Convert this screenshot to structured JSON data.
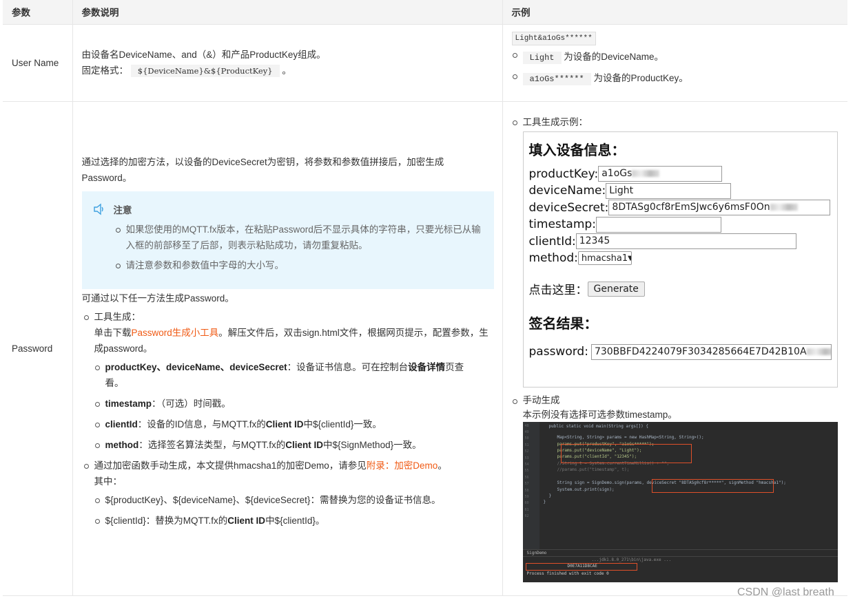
{
  "header": {
    "col_param": "参数",
    "col_desc": "参数说明",
    "col_example": "示例"
  },
  "row_username": {
    "name": "User Name",
    "desc_line1": "由设备名DeviceName、and（&）和产品ProductKey组成。",
    "desc_line2_prefix": "固定格式：",
    "desc_format": "${DeviceName}&${ProductKey}",
    "desc_line2_suffix": "。",
    "example_code": "Light&a1oGs******",
    "example_items": [
      {
        "code": "Light",
        "text": "为设备的DeviceName。"
      },
      {
        "code": "a1oGs******",
        "text": "为设备的ProductKey。"
      }
    ]
  },
  "row_password": {
    "name": "Password",
    "intro": "通过选择的加密方法，以设备的DeviceSecret为密钥，将参数和参数值拼接后，加密生成Password。",
    "note": {
      "title": "注意",
      "items": [
        "如果您使用的MQTT.fx版本，在粘贴Password后不显示具体的字符串，只要光标已从输入框的前部移至了后部，则表示粘贴成功，请勿重复粘贴。",
        "请注意参数和参数值中字母的大小写。"
      ]
    },
    "methods_intro": "可通过以下任一方法生成Password。",
    "tool": {
      "title": "工具生成：",
      "line_prefix": "单击下载",
      "link": "Password生成小工具",
      "line_suffix": "。解压文件后，双击sign.html文件，根据网页提示，配置参数，生成password。",
      "items": [
        {
          "bold": "productKey、deviceName、deviceSecret",
          "text": "：设备证书信息。可在控制台",
          "bold2": "设备详情",
          "text2": "页查看。"
        },
        {
          "bold": "timestamp",
          "text": "：（可选）时间戳。",
          "bold2": "",
          "text2": ""
        },
        {
          "bold": "clientId",
          "text": "：设备的ID信息，与MQTT.fx的",
          "bold2": "Client ID",
          "text2": "中${clientId}一致。"
        },
        {
          "bold": "method",
          "text": "：选择签名算法类型，与MQTT.fx的",
          "bold2": "Client ID",
          "text2": "中${SignMethod}一致。"
        }
      ]
    },
    "manual": {
      "line_prefix": "通过加密函数手动生成，本文提供hmacsha1的加密Demo，请参见",
      "link": "附录：加密Demo",
      "line_suffix": "。",
      "sub": "其中：",
      "items": [
        {
          "text": "${productKey}、${deviceName}、${deviceSecret}：需替换为您的设备证书信息。",
          "bold": "",
          "text2": ""
        },
        {
          "text": "${clientId}：替换为MQTT.fx的",
          "bold": "Client ID",
          "text2": "中${clientId}。"
        }
      ]
    },
    "example": {
      "tool_label": "工具生成示例：",
      "form_title": "填入设备信息：",
      "fields": {
        "productKey_label": "productKey:",
        "productKey_value": "a1oGs",
        "deviceName_label": "deviceName:",
        "deviceName_value": "Light",
        "deviceSecret_label": "deviceSecret:",
        "deviceSecret_value": "8DTASg0cf8rEmSJwc6y6msF0On",
        "timestamp_label": "timestamp:",
        "timestamp_value": "",
        "clientId_label": "clientId:",
        "clientId_value": "12345",
        "method_label": "method:",
        "method_value": "hmacsha1"
      },
      "click_label": "点击这里：",
      "generate_button": "Generate",
      "result_title": "签名结果：",
      "password_label": "password:",
      "password_value": "730BBFD4224079F3034285664E7D42B10A",
      "manual_label": "手动生成",
      "manual_desc": "本示例没有选择可选参数timestamp。",
      "ide": {
        "lines": [
          "public static void main(String args[]) {",
          "Map<String, String> params = new HashMap<String, String>();",
          "params.put(\"productKey\", \"a1oGs*****\");",
          "params.put(\"deviceName\", \"Light\");",
          "params.put(\"clientId\", \"12345\");",
          "//String t = System.currentTimeMillis() + \"\";",
          "//params.put(\"timestamp\", t);",
          "String sign = SignDemo.sign(params, deviceSecret \"8DTASg0cf8r*****\", signMethod \"hmacsha1\");",
          "System.out.print(sign);",
          "}",
          "}"
        ],
        "line_numbers": [
          "48",
          "49",
          "50",
          "51",
          "52",
          "53",
          "54",
          "55",
          "56",
          "57",
          "58",
          "59",
          "60",
          "61",
          "62"
        ],
        "run_tab": "SignDemo",
        "run_output_1": "...jdk1.8.0_271\\bin\\java.exe ...",
        "run_output_2": "D0E7A11D8CAE",
        "run_output_3": "Process finished with exit code 0"
      }
    }
  },
  "watermark": "CSDN @last breath"
}
